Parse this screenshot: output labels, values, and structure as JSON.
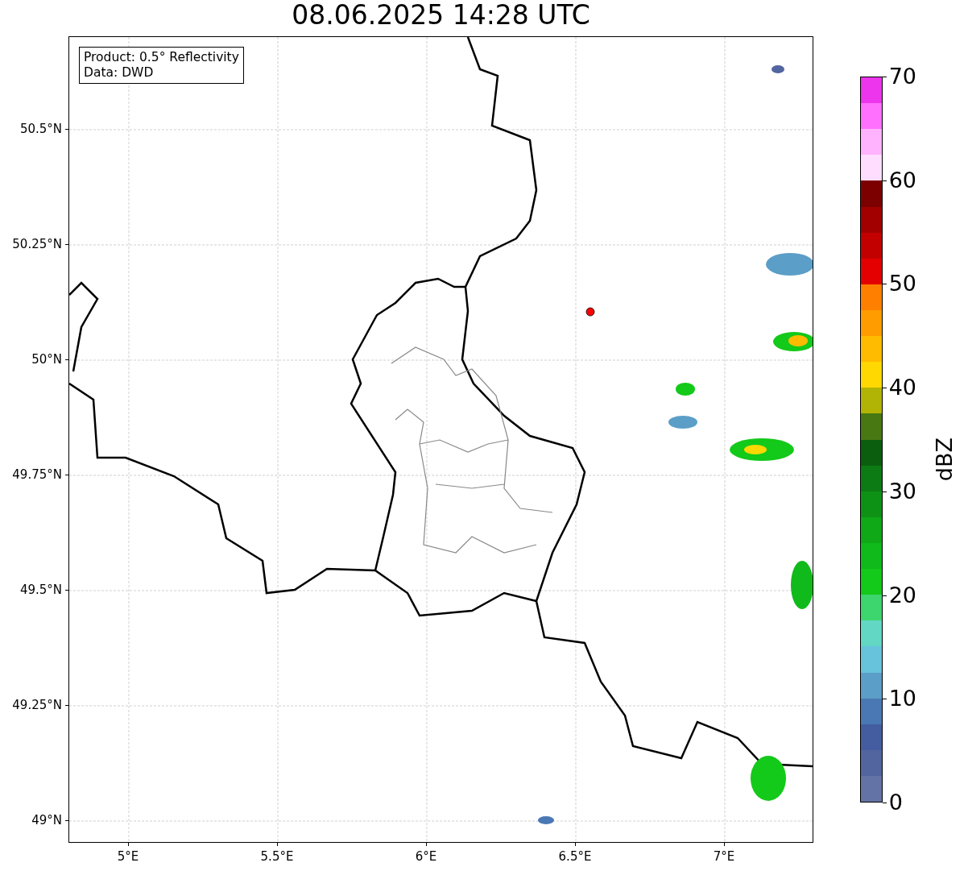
{
  "title": "08.06.2025 14:28 UTC",
  "info_box": {
    "lines": [
      "Product: 0.5° Reflectivity",
      "Data: DWD"
    ]
  },
  "map": {
    "y_ticks": [
      "50.5°N",
      "50.25°N",
      "50°N",
      "49.75°N",
      "49.5°N",
      "49.25°N",
      "49°N"
    ],
    "x_ticks": [
      "5°E",
      "5.5°E",
      "6°E",
      "6.5°E",
      "7°E"
    ]
  },
  "colorbar": {
    "label": "dBZ",
    "ticks": [
      "70",
      "60",
      "50",
      "40",
      "30",
      "20",
      "10",
      "0"
    ],
    "bands": [
      {
        "color": "#ec35ec"
      },
      {
        "color": "#ff70ff"
      },
      {
        "color": "#ffb3ff"
      },
      {
        "color": "#ffddff"
      },
      {
        "color": "#7c0000"
      },
      {
        "color": "#a20000"
      },
      {
        "color": "#c30000"
      },
      {
        "color": "#e40000"
      },
      {
        "color": "#ff7f00"
      },
      {
        "color": "#ff9c00"
      },
      {
        "color": "#ffbb00"
      },
      {
        "color": "#fed800"
      },
      {
        "color": "#b1b405"
      },
      {
        "color": "#477812"
      },
      {
        "color": "#0a5e0e"
      },
      {
        "color": "#0c7b13"
      },
      {
        "color": "#0e9216"
      },
      {
        "color": "#0fa817"
      },
      {
        "color": "#10ba1a"
      },
      {
        "color": "#13c919"
      },
      {
        "color": "#3dd56e"
      },
      {
        "color": "#62d7c4"
      },
      {
        "color": "#67c3dc"
      },
      {
        "color": "#5b9ec7"
      },
      {
        "color": "#4a78b4"
      },
      {
        "color": "#435da0"
      },
      {
        "color": "#52659f"
      },
      {
        "color": "#6473a6"
      }
    ]
  }
}
